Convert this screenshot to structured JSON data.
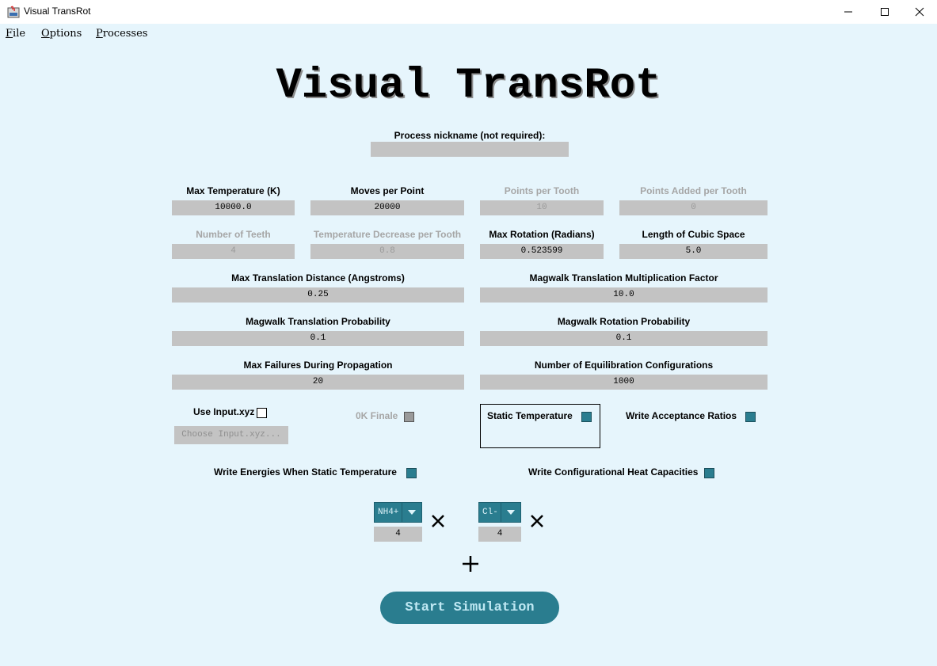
{
  "window": {
    "title": "Visual TransRot",
    "controls": [
      "minimize-icon",
      "maximize-icon",
      "close-icon"
    ]
  },
  "menu": [
    {
      "underline": "F",
      "rest": "ile"
    },
    {
      "underline": "O",
      "rest": "ptions"
    },
    {
      "underline": "P",
      "rest": "rocesses"
    }
  ],
  "heading": "Visual TransRot",
  "nickname": {
    "label": "Process nickname (not required):",
    "value": ""
  },
  "params": {
    "max_temp": {
      "label": "Max Temperature (K)",
      "value": "10000.0"
    },
    "moves_per_point": {
      "label": "Moves per Point",
      "value": "20000"
    },
    "points_per_tooth": {
      "label": "Points per Tooth",
      "value": "10"
    },
    "points_added_per_tooth": {
      "label": "Points Added per Tooth",
      "value": "0"
    },
    "number_of_teeth": {
      "label": "Number of Teeth",
      "value": "4"
    },
    "temp_decrease_per_tooth": {
      "label": "Temperature Decrease per Tooth",
      "value": "0.8"
    },
    "max_rotation": {
      "label": "Max Rotation (Radians)",
      "value": "0.523599"
    },
    "cubic_space": {
      "label": "Length of Cubic Space",
      "value": "5.0"
    },
    "max_translation": {
      "label": "Max Translation Distance (Angstroms)",
      "value": "0.25"
    },
    "magwalk_trans_factor": {
      "label": "Magwalk Translation Multiplication Factor",
      "value": "10.0"
    },
    "magwalk_trans_prob": {
      "label": "Magwalk Translation Probability",
      "value": "0.1"
    },
    "magwalk_rot_prob": {
      "label": "Magwalk Rotation Probability",
      "value": "0.1"
    },
    "max_failures": {
      "label": "Max Failures During Propagation",
      "value": "20"
    },
    "equilibration_configs": {
      "label": "Number of Equilibration Configurations",
      "value": "1000"
    }
  },
  "options": {
    "use_input": {
      "label": "Use Input.xyz",
      "checked": false
    },
    "choose_input": {
      "label": "Choose Input.xyz..."
    },
    "ok_finale": {
      "label": "0K Finale",
      "enabled": false
    },
    "static_temp": {
      "label": "Static Temperature",
      "checked": true
    },
    "write_acceptance": {
      "label": "Write Acceptance Ratios",
      "checked": true
    },
    "write_energies": {
      "label": "Write Energies When Static Temperature",
      "checked": true
    },
    "write_heat_cap": {
      "label": "Write Configurational Heat Capacities",
      "checked": true
    }
  },
  "molecules": [
    {
      "name": "NH4+",
      "count": "4"
    },
    {
      "name": "Cl-",
      "count": "4"
    }
  ],
  "start_button": "Start Simulation",
  "colors": {
    "background": "#e6f5fc",
    "accent": "#2a7d8f",
    "field": "#c3c3c3",
    "disabled_text": "#a6a6a6"
  }
}
